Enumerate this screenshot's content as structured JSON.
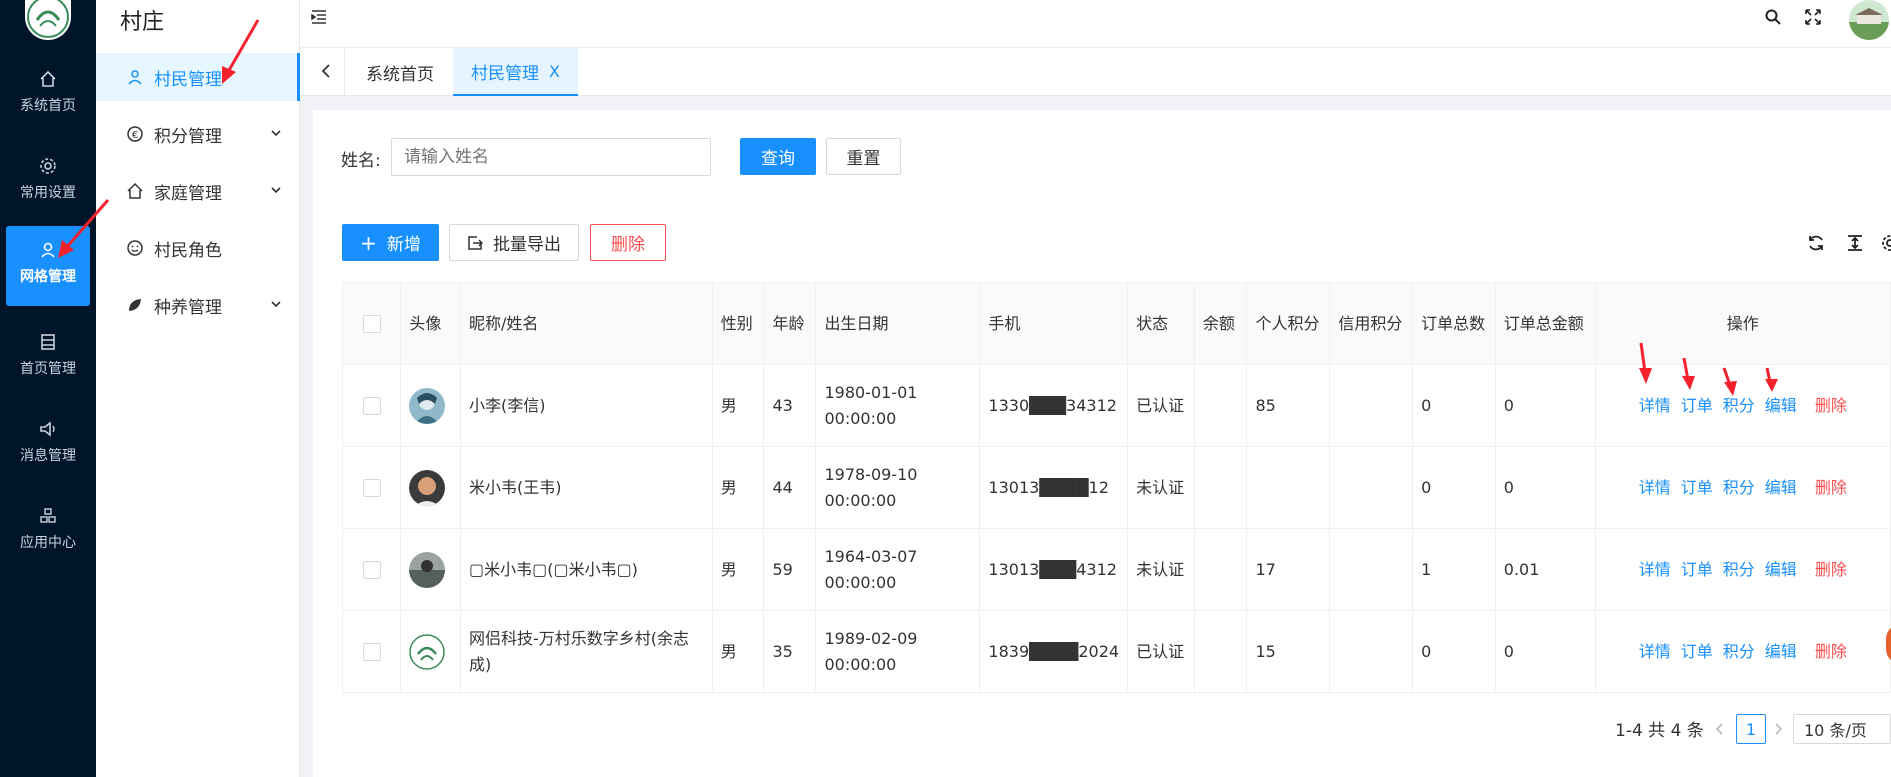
{
  "app": {
    "title": "村庄"
  },
  "rail": {
    "items": [
      {
        "label": "系统首页",
        "icon": "home-icon"
      },
      {
        "label": "常用设置",
        "icon": "gear-icon"
      },
      {
        "label": "网格管理",
        "icon": "user-icon",
        "active": true
      },
      {
        "label": "首页管理",
        "icon": "layout-icon"
      },
      {
        "label": "消息管理",
        "icon": "speaker-icon"
      },
      {
        "label": "应用中心",
        "icon": "apps-icon"
      }
    ]
  },
  "submenu": {
    "items": [
      {
        "label": "村民管理",
        "icon": "user-icon",
        "active": true,
        "expandable": false
      },
      {
        "label": "积分管理",
        "icon": "euro-icon",
        "expandable": true
      },
      {
        "label": "家庭管理",
        "icon": "home-icon",
        "expandable": true
      },
      {
        "label": "村民角色",
        "icon": "smile-icon",
        "expandable": false
      },
      {
        "label": "种养管理",
        "icon": "leaf-icon",
        "expandable": true
      }
    ]
  },
  "tabs": [
    {
      "label": "系统首页",
      "active": false
    },
    {
      "label": "村民管理",
      "active": true,
      "close": "X"
    }
  ],
  "search": {
    "name_label": "姓名:",
    "name_placeholder": "请输入姓名",
    "query_button": "查询",
    "reset_button": "重置"
  },
  "toolbar": {
    "add_button": "新增",
    "add_icon": "+",
    "export_button": "批量导出",
    "delete_button": "删除"
  },
  "table": {
    "columns": [
      "头像",
      "昵称/姓名",
      "性别",
      "年龄",
      "出生日期",
      "手机",
      "状态",
      "余额",
      "个人积分",
      "信用积分",
      "订单总数",
      "订单总金额",
      "操作"
    ],
    "actions": {
      "detail": "详情",
      "order": "订单",
      "points": "积分",
      "edit": "编辑",
      "delete": "删除"
    },
    "rows": [
      {
        "name": "小李(李信)",
        "gender": "男",
        "age": "43",
        "birth_date": "1980-01-01",
        "birth_time": "00:00:00",
        "phone": "1330███34312",
        "status": "已认证",
        "balance": "",
        "points": "85",
        "credit": "",
        "orders": "0",
        "amount": "0"
      },
      {
        "name": "米小韦(王韦)",
        "gender": "男",
        "age": "44",
        "birth_date": "1978-09-10",
        "birth_time": "00:00:00",
        "phone": "13013████12",
        "status": "未认证",
        "balance": "",
        "points": "",
        "credit": "",
        "orders": "0",
        "amount": "0"
      },
      {
        "name": "▢米小韦▢(▢米小韦▢)",
        "gender": "男",
        "age": "59",
        "birth_date": "1964-03-07",
        "birth_time": "00:00:00",
        "phone": "13013███4312",
        "status": "未认证",
        "balance": "",
        "points": "17",
        "credit": "",
        "orders": "1",
        "amount": "0.01"
      },
      {
        "name": "网侣科技-万村乐数字乡村(余志成)",
        "gender": "男",
        "age": "35",
        "birth_date": "1989-02-09",
        "birth_time": "00:00:00",
        "phone": "1839████2024",
        "status": "已认证",
        "balance": "",
        "points": "15",
        "credit": "",
        "orders": "0",
        "amount": "0"
      }
    ]
  },
  "pagination": {
    "summary": "1-4 共 4 条",
    "current": "1",
    "page_size": "10 条/页"
  },
  "colors": {
    "primary": "#1890ff",
    "danger": "#ff4d4f",
    "rail_bg": "#001529",
    "annotation": "#f5222d"
  }
}
